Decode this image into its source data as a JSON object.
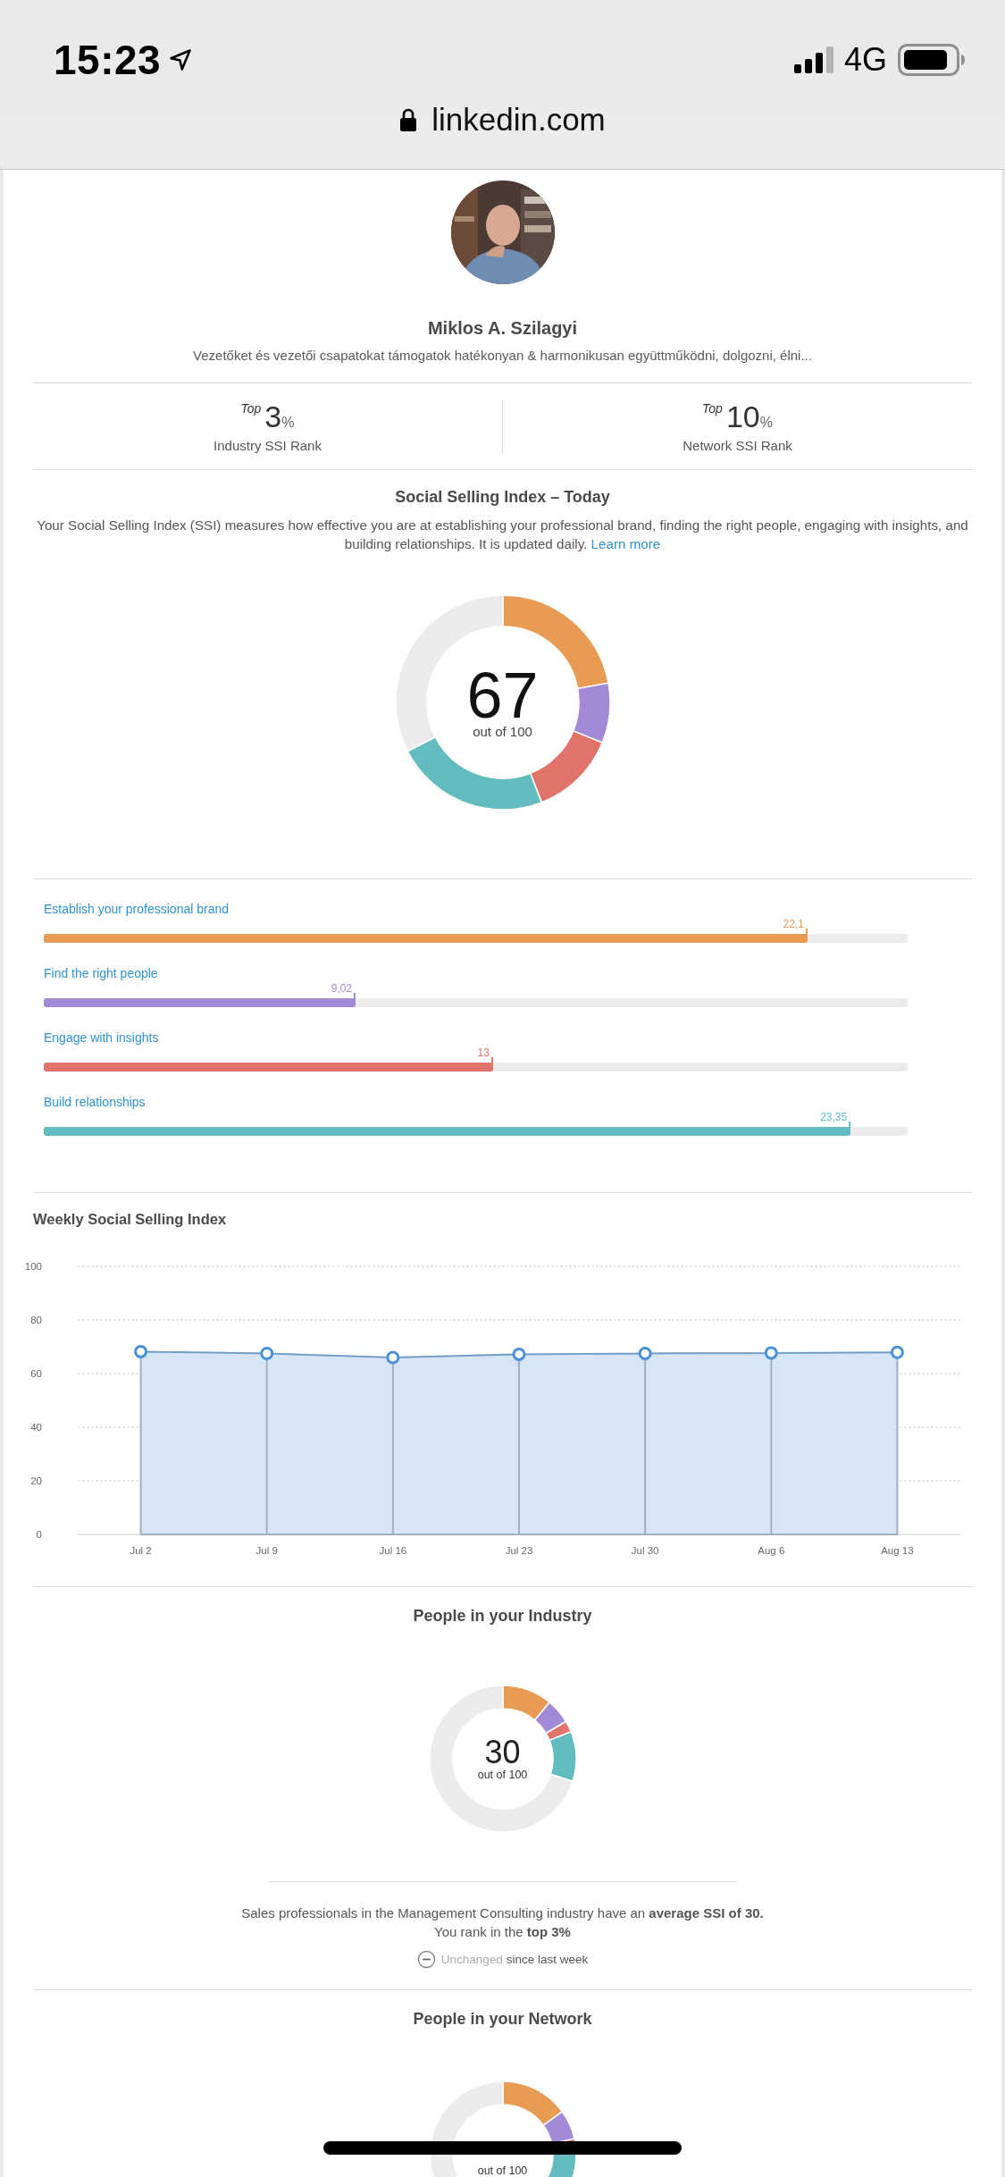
{
  "status_bar": {
    "time": "15:23",
    "network": "4G"
  },
  "address_bar": {
    "url": "linkedin.com"
  },
  "profile": {
    "name": "Miklos A. Szilagyi",
    "headline": "Vezetőket és vezetői csapatokat támogatok hatékonyan & harmonikusan együttműködni, dolgozni, élni..."
  },
  "ranks": [
    {
      "prefix": "Top",
      "value": "3",
      "unit": "%",
      "label": "Industry SSI Rank"
    },
    {
      "prefix": "Top",
      "value": "10",
      "unit": "%",
      "label": "Network SSI Rank"
    }
  ],
  "ssi": {
    "title": "Social Selling Index – Today",
    "description": "Your Social Selling Index (SSI) measures how effective you are at establishing your professional brand, finding the right people, engaging with insights, and building relationships. It is updated daily.",
    "link": "Learn more",
    "score": "67",
    "score_caption": "out of 100",
    "components": [
      {
        "label": "Establish your professional brand",
        "reading": "22,1",
        "level": 0.884,
        "color": "#e89b52"
      },
      {
        "label": "Find the right people",
        "reading": "9,02",
        "level": 0.361,
        "color": "#a28ad6"
      },
      {
        "label": "Engage with insights",
        "reading": "13",
        "level": 0.52,
        "color": "#e0736a"
      },
      {
        "label": "Build relationships",
        "reading": "23,35",
        "level": 0.934,
        "color": "#62bcc0"
      }
    ]
  },
  "weekly": {
    "title": "Weekly Social Selling Index",
    "chart_data": {
      "type": "area",
      "categories": [
        "Jul 2",
        "Jul 9",
        "Jul 16",
        "Jul 23",
        "Jul 30",
        "Aug 6",
        "Aug 13"
      ],
      "series": [
        {
          "color": "#4a90d9",
          "values": [
            68.2,
            67.5,
            66,
            67.2,
            67.5,
            67.7,
            67.9
          ]
        }
      ],
      "ylim": [
        0,
        100
      ],
      "yticks": [
        0,
        20,
        40,
        60,
        80,
        100
      ],
      "grid": true
    }
  },
  "industry": {
    "title": "People in your Industry",
    "score": "30",
    "score_caption": "out of 100",
    "summary": "Sales professionals in the Management Consulting industry have an **average SSI of 30.**",
    "rank_line": "You rank in the **top 3%**",
    "trend": "Unchanged",
    "trend_suffix": "since last week"
  },
  "network": {
    "title": "People in your Network",
    "score_caption": "out of 100"
  }
}
